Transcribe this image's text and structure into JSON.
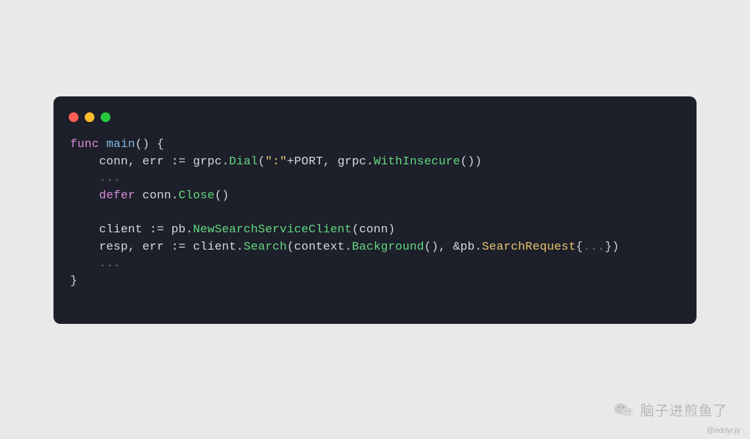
{
  "code": {
    "tokens": [
      {
        "line": 0,
        "cls": "tk-keyword",
        "text": "func"
      },
      {
        "line": 0,
        "cls": "tk-punct",
        "text": " "
      },
      {
        "line": 0,
        "cls": "tk-func",
        "text": "main"
      },
      {
        "line": 0,
        "cls": "tk-punct",
        "text": "() {"
      },
      {
        "line": 1,
        "cls": "tk-punct",
        "text": "    "
      },
      {
        "line": 1,
        "cls": "tk-ident",
        "text": "conn"
      },
      {
        "line": 1,
        "cls": "tk-punct",
        "text": ", "
      },
      {
        "line": 1,
        "cls": "tk-ident",
        "text": "err"
      },
      {
        "line": 1,
        "cls": "tk-punct",
        "text": " "
      },
      {
        "line": 1,
        "cls": "tk-op",
        "text": ":="
      },
      {
        "line": 1,
        "cls": "tk-punct",
        "text": " "
      },
      {
        "line": 1,
        "cls": "tk-pkg",
        "text": "grpc"
      },
      {
        "line": 1,
        "cls": "tk-punct",
        "text": "."
      },
      {
        "line": 1,
        "cls": "tk-method",
        "text": "Dial"
      },
      {
        "line": 1,
        "cls": "tk-punct",
        "text": "("
      },
      {
        "line": 1,
        "cls": "tk-string",
        "text": "\":\""
      },
      {
        "line": 1,
        "cls": "tk-op",
        "text": "+"
      },
      {
        "line": 1,
        "cls": "tk-ident",
        "text": "PORT"
      },
      {
        "line": 1,
        "cls": "tk-punct",
        "text": ", "
      },
      {
        "line": 1,
        "cls": "tk-pkg",
        "text": "grpc"
      },
      {
        "line": 1,
        "cls": "tk-punct",
        "text": "."
      },
      {
        "line": 1,
        "cls": "tk-method",
        "text": "WithInsecure"
      },
      {
        "line": 1,
        "cls": "tk-punct",
        "text": "())"
      },
      {
        "line": 2,
        "cls": "tk-punct",
        "text": "    "
      },
      {
        "line": 2,
        "cls": "tk-comment",
        "text": "..."
      },
      {
        "line": 3,
        "cls": "tk-punct",
        "text": "    "
      },
      {
        "line": 3,
        "cls": "tk-keyword",
        "text": "defer"
      },
      {
        "line": 3,
        "cls": "tk-punct",
        "text": " "
      },
      {
        "line": 3,
        "cls": "tk-ident",
        "text": "conn"
      },
      {
        "line": 3,
        "cls": "tk-punct",
        "text": "."
      },
      {
        "line": 3,
        "cls": "tk-method",
        "text": "Close"
      },
      {
        "line": 3,
        "cls": "tk-punct",
        "text": "()"
      },
      {
        "line": 4,
        "cls": "tk-punct",
        "text": ""
      },
      {
        "line": 5,
        "cls": "tk-punct",
        "text": "    "
      },
      {
        "line": 5,
        "cls": "tk-ident",
        "text": "client"
      },
      {
        "line": 5,
        "cls": "tk-punct",
        "text": " "
      },
      {
        "line": 5,
        "cls": "tk-op",
        "text": ":="
      },
      {
        "line": 5,
        "cls": "tk-punct",
        "text": " "
      },
      {
        "line": 5,
        "cls": "tk-pkg",
        "text": "pb"
      },
      {
        "line": 5,
        "cls": "tk-punct",
        "text": "."
      },
      {
        "line": 5,
        "cls": "tk-method",
        "text": "NewSearchServiceClient"
      },
      {
        "line": 5,
        "cls": "tk-punct",
        "text": "("
      },
      {
        "line": 5,
        "cls": "tk-ident",
        "text": "conn"
      },
      {
        "line": 5,
        "cls": "tk-punct",
        "text": ")"
      },
      {
        "line": 6,
        "cls": "tk-punct",
        "text": "    "
      },
      {
        "line": 6,
        "cls": "tk-ident",
        "text": "resp"
      },
      {
        "line": 6,
        "cls": "tk-punct",
        "text": ", "
      },
      {
        "line": 6,
        "cls": "tk-ident",
        "text": "err"
      },
      {
        "line": 6,
        "cls": "tk-punct",
        "text": " "
      },
      {
        "line": 6,
        "cls": "tk-op",
        "text": ":="
      },
      {
        "line": 6,
        "cls": "tk-punct",
        "text": " "
      },
      {
        "line": 6,
        "cls": "tk-ident",
        "text": "client"
      },
      {
        "line": 6,
        "cls": "tk-punct",
        "text": "."
      },
      {
        "line": 6,
        "cls": "tk-method",
        "text": "Search"
      },
      {
        "line": 6,
        "cls": "tk-punct",
        "text": "("
      },
      {
        "line": 6,
        "cls": "tk-pkg",
        "text": "context"
      },
      {
        "line": 6,
        "cls": "tk-punct",
        "text": "."
      },
      {
        "line": 6,
        "cls": "tk-method",
        "text": "Background"
      },
      {
        "line": 6,
        "cls": "tk-punct",
        "text": "(), "
      },
      {
        "line": 6,
        "cls": "tk-amp",
        "text": "&"
      },
      {
        "line": 6,
        "cls": "tk-pkg",
        "text": "pb"
      },
      {
        "line": 6,
        "cls": "tk-punct",
        "text": "."
      },
      {
        "line": 6,
        "cls": "tk-type",
        "text": "SearchRequest"
      },
      {
        "line": 6,
        "cls": "tk-punct",
        "text": "{"
      },
      {
        "line": 6,
        "cls": "tk-comment",
        "text": "..."
      },
      {
        "line": 6,
        "cls": "tk-punct",
        "text": "})"
      },
      {
        "line": 7,
        "cls": "tk-punct",
        "text": "    "
      },
      {
        "line": 7,
        "cls": "tk-comment",
        "text": "..."
      },
      {
        "line": 8,
        "cls": "tk-punct",
        "text": "}"
      }
    ]
  },
  "watermark": {
    "text": "脑子进煎鱼了",
    "handle": "@eddycjy"
  }
}
